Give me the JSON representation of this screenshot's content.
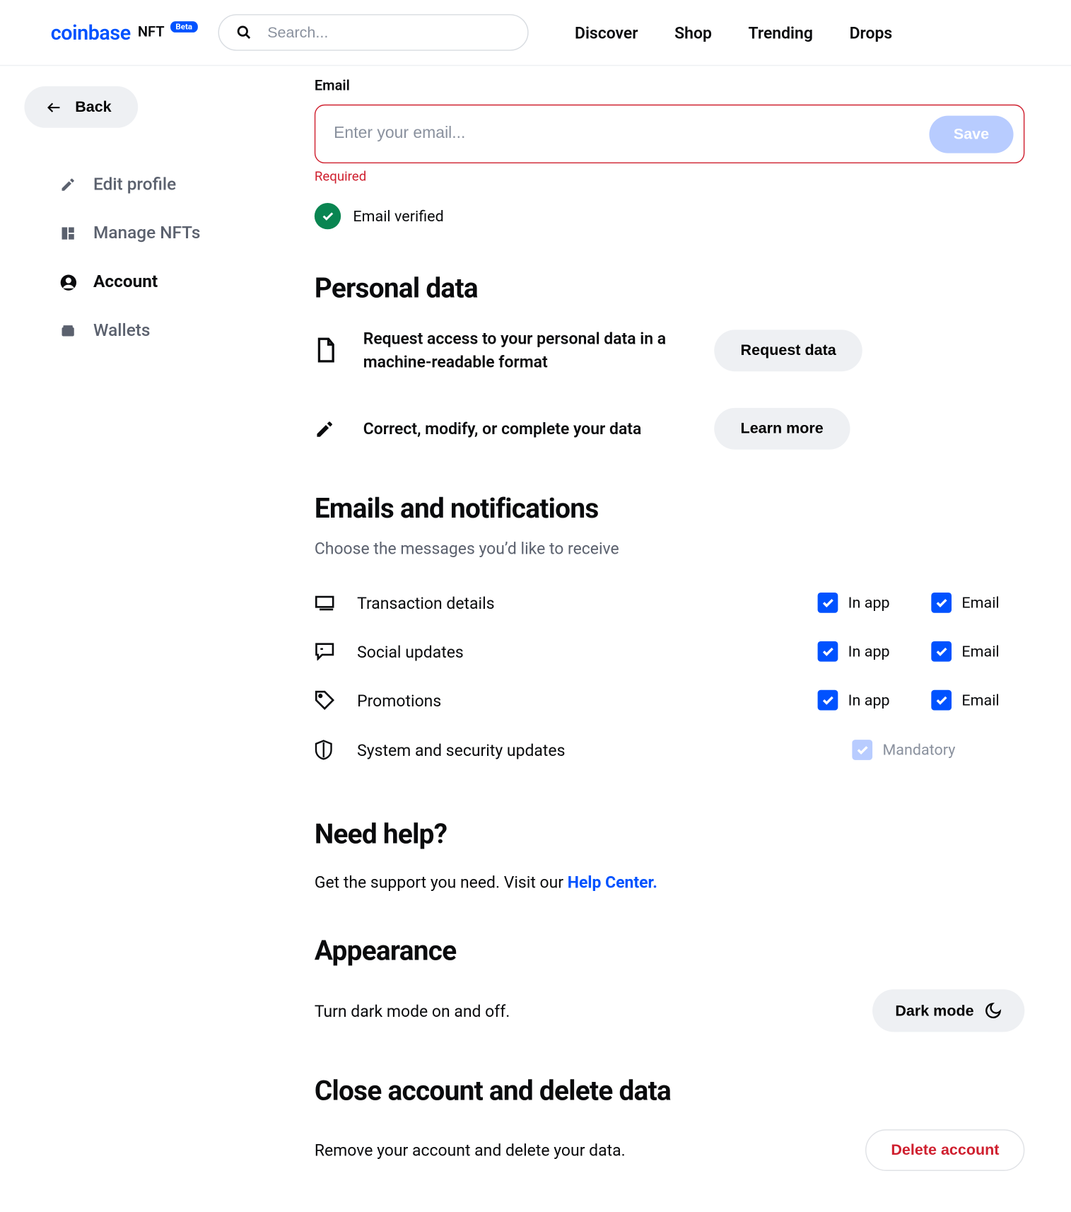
{
  "header": {
    "logo_main": "coinbase",
    "logo_sub": "NFT",
    "beta": "Beta",
    "search_placeholder": "Search...",
    "nav": [
      "Discover",
      "Shop",
      "Trending",
      "Drops"
    ]
  },
  "sidebar": {
    "back_label": "Back",
    "items": [
      {
        "label": "Edit profile"
      },
      {
        "label": "Manage NFTs"
      },
      {
        "label": "Account"
      },
      {
        "label": "Wallets"
      }
    ]
  },
  "email": {
    "label": "Email",
    "placeholder": "Enter your email...",
    "save_label": "Save",
    "error": "Required",
    "verified_text": "Email verified"
  },
  "personal": {
    "heading": "Personal data",
    "row1_text": "Request access to your personal data in a machine-readable format",
    "row1_btn": "Request data",
    "row2_text": "Correct, modify, or complete your data",
    "row2_btn": "Learn more"
  },
  "notif": {
    "heading": "Emails and notifications",
    "sub": "Choose the messages you’d like to receive",
    "inapp_label": "In app",
    "email_label": "Email",
    "mandatory_label": "Mandatory",
    "rows": [
      {
        "label": "Transaction details"
      },
      {
        "label": "Social updates"
      },
      {
        "label": "Promotions"
      },
      {
        "label": "System and security updates"
      }
    ]
  },
  "help": {
    "heading": "Need help?",
    "text_pre": "Get the support you need. Visit our ",
    "link": "Help Center."
  },
  "appearance": {
    "heading": "Appearance",
    "text": "Turn dark mode on and off.",
    "btn": "Dark mode"
  },
  "close": {
    "heading": "Close account and delete data",
    "text": "Remove your account and delete your data.",
    "btn": "Delete account"
  }
}
